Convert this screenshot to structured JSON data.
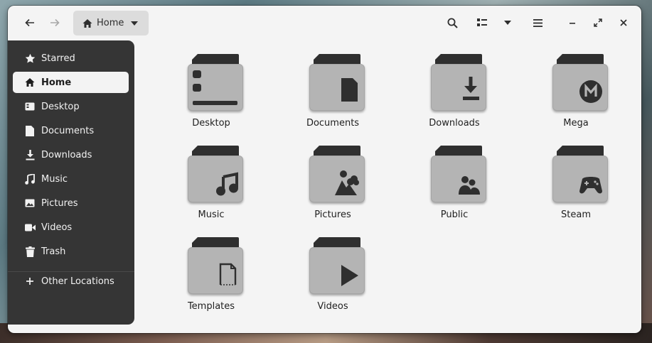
{
  "window": {
    "path_label": "Home"
  },
  "header": {
    "back_icon": "arrow-left-icon",
    "forward_icon": "arrow-right-icon",
    "home_icon": "home-icon",
    "search_icon": "search-icon",
    "view_icon": "list-view-icon",
    "menu_icon": "hamburger-icon"
  },
  "sidebar": {
    "items": [
      {
        "label": "Starred",
        "icon": "star-icon"
      },
      {
        "label": "Home",
        "icon": "home-icon",
        "active": true
      },
      {
        "label": "Desktop",
        "icon": "desktop-icon"
      },
      {
        "label": "Documents",
        "icon": "document-icon"
      },
      {
        "label": "Downloads",
        "icon": "download-icon"
      },
      {
        "label": "Music",
        "icon": "music-icon"
      },
      {
        "label": "Pictures",
        "icon": "picture-icon"
      },
      {
        "label": "Videos",
        "icon": "video-icon"
      },
      {
        "label": "Trash",
        "icon": "trash-icon"
      }
    ],
    "other_locations": {
      "label": "Other Locations",
      "icon": "plus-icon"
    }
  },
  "files": [
    {
      "name": "Desktop",
      "icon": "desktop-folder-icon"
    },
    {
      "name": "Documents",
      "icon": "documents-folder-icon"
    },
    {
      "name": "Downloads",
      "icon": "downloads-folder-icon"
    },
    {
      "name": "Mega",
      "icon": "mega-folder-icon"
    },
    {
      "name": "Music",
      "icon": "music-folder-icon"
    },
    {
      "name": "Pictures",
      "icon": "pictures-folder-icon"
    },
    {
      "name": "Public",
      "icon": "public-folder-icon"
    },
    {
      "name": "Steam",
      "icon": "steam-folder-icon"
    },
    {
      "name": "Templates",
      "icon": "templates-folder-icon"
    },
    {
      "name": "Videos",
      "icon": "videos-folder-icon"
    }
  ],
  "colors": {
    "sidebar_bg": "#353535",
    "content_bg": "#f4f4f4",
    "folder_body": "#b4b4b4",
    "folder_tab": "#2f2f2f"
  }
}
